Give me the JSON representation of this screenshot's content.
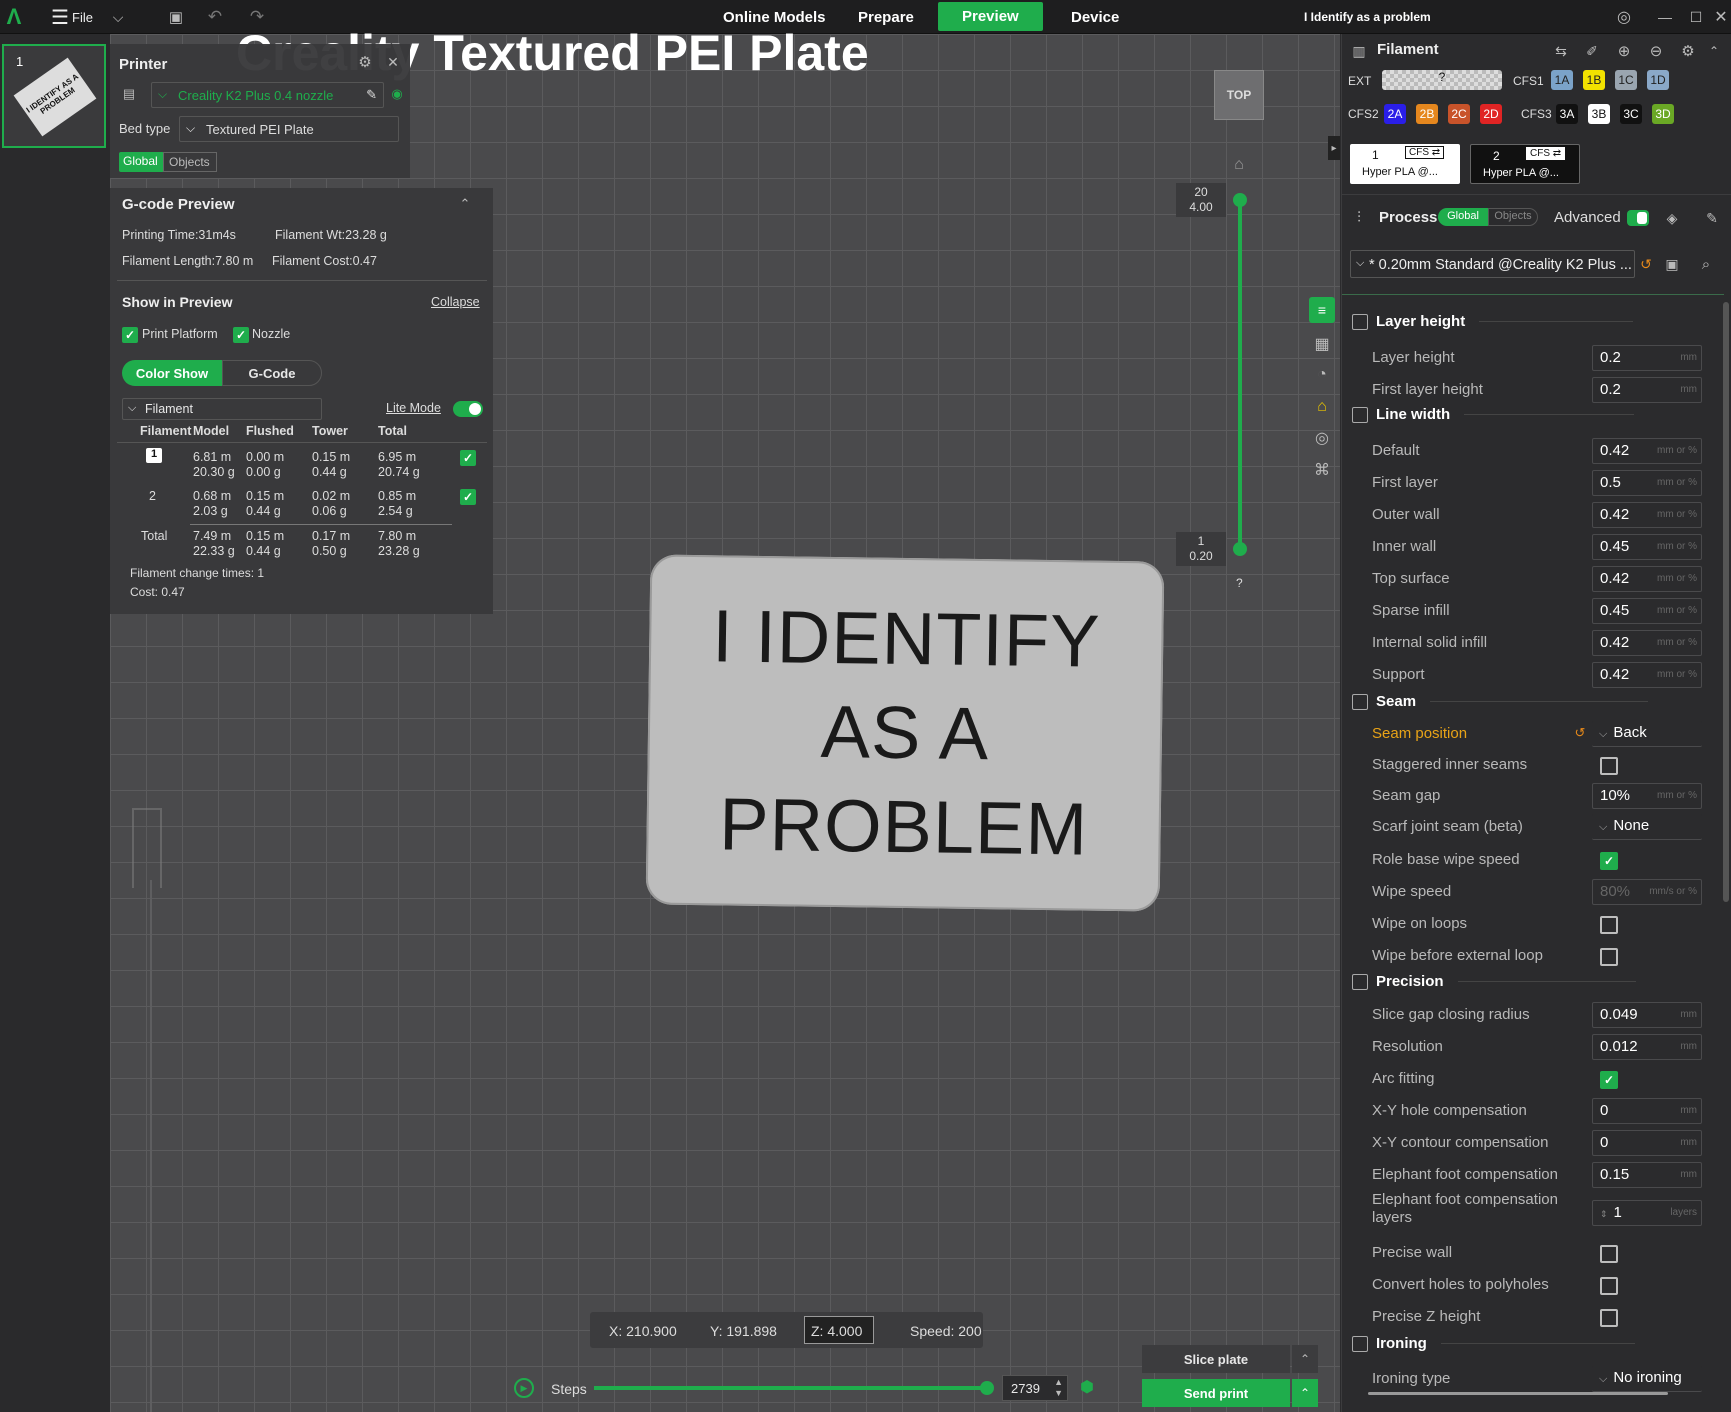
{
  "topbar": {
    "file": "File",
    "tabs": [
      "Online Models",
      "Prepare",
      "Preview",
      "Device"
    ],
    "title": "I Identify as a problem"
  },
  "thumb": {
    "index": "1",
    "text": "I IDENTIFY AS A PROBLEM"
  },
  "plate_title": "Creality Textured PEI Plate",
  "printer": {
    "title": "Printer",
    "name": "Creality K2 Plus 0.4 nozzle",
    "bed_label": "Bed type",
    "bed": "Textured PEI Plate",
    "tab_global": "Global",
    "tab_objects": "Objects"
  },
  "gcode": {
    "title": "G-code Preview",
    "time": "Printing Time:31m4s",
    "wt": "Filament Wt:23.28 g",
    "length": "Filament Length:7.80 m",
    "cost": "Filament Cost:0.47",
    "show": "Show in Preview",
    "collapse": "Collapse",
    "platform": "Print Platform",
    "nozzle": "Nozzle",
    "color_show": "Color Show",
    "gcode_tab": "G-Code",
    "filament_sel": "Filament",
    "lite": "Lite Mode",
    "headers": [
      "Filament",
      "Model",
      "Flushed",
      "Tower",
      "Total"
    ],
    "rows": [
      {
        "id": "1",
        "model": "6.81 m\n20.30 g",
        "flushed": "0.00 m\n0.00 g",
        "tower": "0.15 m\n0.44 g",
        "total": "6.95 m\n20.74 g"
      },
      {
        "id": "2",
        "model": "0.68 m\n2.03 g",
        "flushed": "0.15 m\n0.44 g",
        "tower": "0.02 m\n0.06 g",
        "total": "0.85 m\n2.54 g"
      }
    ],
    "total": {
      "label": "Total",
      "model": "7.49 m\n22.33 g",
      "flushed": "0.15 m\n0.44 g",
      "tower": "0.17 m\n0.50 g",
      "total": "7.80 m\n23.28 g"
    },
    "changes": "Filament change times:  1",
    "costline": "Cost:  0.47"
  },
  "plate": [
    "I IDENTIFY",
    "AS A",
    "PROBLEM"
  ],
  "view": {
    "top": "TOP",
    "upper": "20\n4.00",
    "lower": "1\n0.20",
    "q": "?"
  },
  "status": {
    "x": "X: 210.900",
    "y": "Y: 191.898",
    "z": "Z: 4.000",
    "speed": "Speed: 200"
  },
  "steps": {
    "label": "Steps",
    "value": "2739"
  },
  "actions": {
    "slice": "Slice plate",
    "send": "Send print"
  },
  "filament": {
    "title": "Filament",
    "ext": "EXT",
    "cfs1": "CFS1",
    "cfs2": "CFS2",
    "cfs3": "CFS3",
    "slots1": [
      "1A",
      "1B",
      "1C",
      "1D"
    ],
    "slots2": [
      "2A",
      "2B",
      "2C",
      "2D"
    ],
    "slots3": [
      "3A",
      "3B",
      "3C",
      "3D"
    ],
    "f1": "1",
    "f2": "2",
    "f_name": "Hyper PLA @...",
    "cfs_tag": "CFS ⇄"
  },
  "process": {
    "title": "Process",
    "global": "Global",
    "objects": "Objects",
    "advanced": "Advanced",
    "preset": "* 0.20mm Standard @Creality K2 Plus ..."
  },
  "settings": [
    {
      "type": "section",
      "label": "Layer height"
    },
    {
      "label": "Layer height",
      "value": "0.2",
      "unit": "mm"
    },
    {
      "label": "First layer height",
      "value": "0.2",
      "unit": "mm"
    },
    {
      "type": "section",
      "label": "Line width"
    },
    {
      "label": "Default",
      "value": "0.42",
      "unit": "mm or %"
    },
    {
      "label": "First layer",
      "value": "0.5",
      "unit": "mm or %"
    },
    {
      "label": "Outer wall",
      "value": "0.42",
      "unit": "mm or %"
    },
    {
      "label": "Inner wall",
      "value": "0.45",
      "unit": "mm or %"
    },
    {
      "label": "Top surface",
      "value": "0.42",
      "unit": "mm or %"
    },
    {
      "label": "Sparse infill",
      "value": "0.45",
      "unit": "mm or %"
    },
    {
      "label": "Internal solid infill",
      "value": "0.42",
      "unit": "mm or %"
    },
    {
      "label": "Support",
      "value": "0.42",
      "unit": "mm or %"
    },
    {
      "type": "section",
      "label": "Seam"
    },
    {
      "label": "Seam position",
      "value": "Back",
      "kind": "select",
      "modified": true
    },
    {
      "label": "Staggered inner seams",
      "kind": "check",
      "checked": false
    },
    {
      "label": "Seam gap",
      "value": "10%",
      "unit": "mm or %"
    },
    {
      "label": "Scarf joint seam (beta)",
      "value": "None",
      "kind": "select"
    },
    {
      "label": "Role base wipe speed",
      "kind": "check",
      "checked": true
    },
    {
      "label": "Wipe speed",
      "value": "80%",
      "unit": "mm/s or %",
      "disabled": true
    },
    {
      "label": "Wipe on loops",
      "kind": "check",
      "checked": false
    },
    {
      "label": "Wipe before external loop",
      "kind": "check",
      "checked": false
    },
    {
      "type": "section",
      "label": "Precision"
    },
    {
      "label": "Slice gap closing radius",
      "value": "0.049",
      "unit": "mm"
    },
    {
      "label": "Resolution",
      "value": "0.012",
      "unit": "mm"
    },
    {
      "label": "Arc fitting",
      "kind": "check",
      "checked": true
    },
    {
      "label": "X-Y hole compensation",
      "value": "0",
      "unit": "mm"
    },
    {
      "label": "X-Y contour compensation",
      "value": "0",
      "unit": "mm"
    },
    {
      "label": "Elephant foot compensation",
      "value": "0.15",
      "unit": "mm"
    },
    {
      "label": "Elephant foot compensation\nlayers",
      "value": "1",
      "unit": "layers",
      "kind": "spin"
    },
    {
      "label": "Precise wall",
      "kind": "check",
      "checked": false
    },
    {
      "label": "Convert holes to polyholes",
      "kind": "check",
      "checked": false
    },
    {
      "label": "Precise Z height",
      "kind": "check",
      "checked": false
    },
    {
      "type": "section",
      "label": "Ironing"
    },
    {
      "label": "Ironing type",
      "value": "No ironing",
      "kind": "select"
    }
  ]
}
